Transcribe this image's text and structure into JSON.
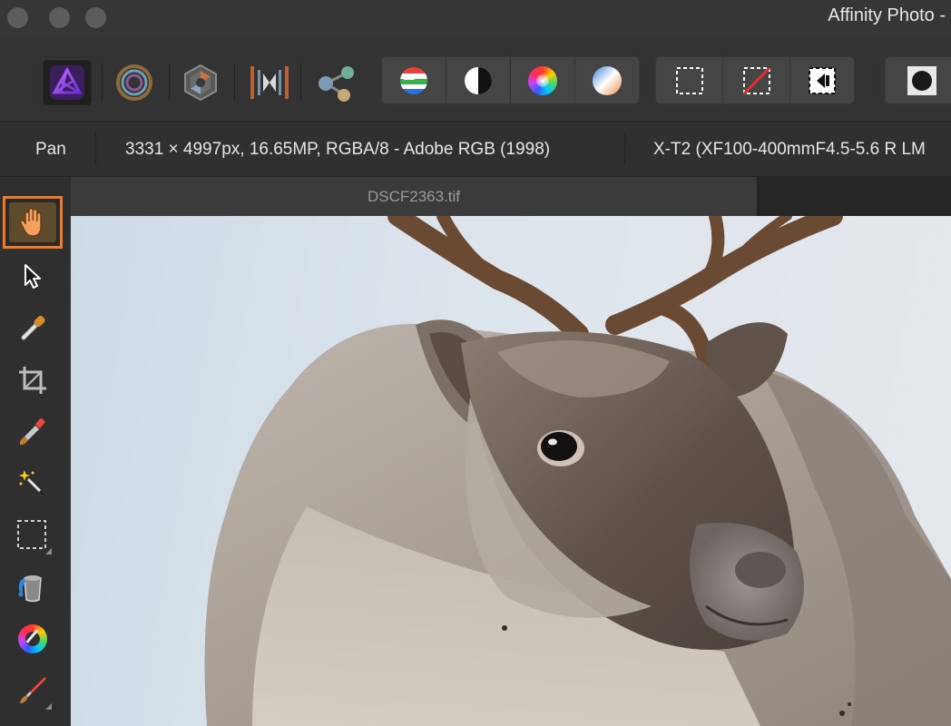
{
  "window": {
    "title": "Affinity Photo -",
    "controls": [
      "close",
      "minimize",
      "zoom"
    ]
  },
  "toolbar": {
    "personas": [
      {
        "name": "photo-persona",
        "icon": "affinity-photo-triangle-icon",
        "active": true
      },
      {
        "name": "liquify-persona",
        "icon": "liquify-rings-icon",
        "active": false
      },
      {
        "name": "develop-persona",
        "icon": "develop-aperture-icon",
        "active": false
      },
      {
        "name": "tone-mapping-persona",
        "icon": "tone-mapping-icon",
        "active": false
      },
      {
        "name": "export-persona",
        "icon": "export-nodes-icon",
        "active": false
      }
    ],
    "adjust_group": [
      "auto-levels-icon",
      "auto-contrast-icon",
      "auto-colour-icon",
      "auto-white-balance-icon"
    ],
    "selection_group": [
      "select-all-icon",
      "deselect-icon",
      "invert-selection-icon"
    ],
    "mask_button": "quick-mask-icon"
  },
  "context": {
    "tool_name": "Pan",
    "document_info": "3331 × 4997px, 16.65MP, RGBA/8 - Adobe RGB (1998)",
    "camera_info": "X-T2 (XF100-400mmF4.5-5.6 R LM"
  },
  "tools": [
    {
      "name": "pan-tool",
      "icon": "hand-icon",
      "active": true
    },
    {
      "name": "move-tool",
      "icon": "pointer-arrow-icon"
    },
    {
      "name": "colour-picker-tool",
      "icon": "eyedropper-icon"
    },
    {
      "name": "crop-tool",
      "icon": "crop-icon"
    },
    {
      "name": "selection-brush-tool",
      "icon": "selection-brush-icon"
    },
    {
      "name": "flood-select-tool",
      "icon": "magic-wand-icon"
    },
    {
      "name": "rectangular-marquee-tool",
      "icon": "marquee-icon"
    },
    {
      "name": "flood-fill-tool",
      "icon": "paint-bucket-icon"
    },
    {
      "name": "gradient-tool",
      "icon": "colour-wheel-icon"
    },
    {
      "name": "paint-brush-tool",
      "icon": "paint-brush-icon"
    }
  ],
  "document": {
    "tab_name": "DSCF2363.tif",
    "image_subject": "reindeer"
  },
  "colors": {
    "accent": "#f07b24",
    "background": "#2c2c2c"
  }
}
